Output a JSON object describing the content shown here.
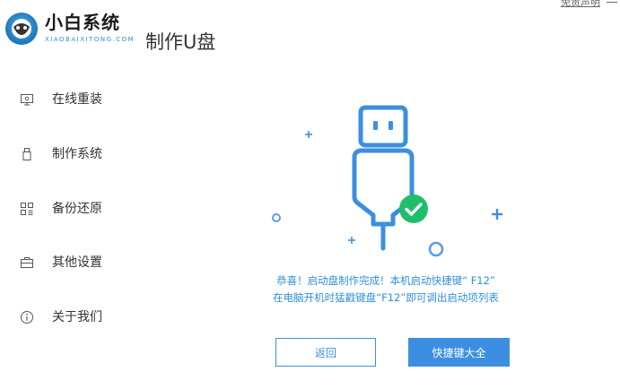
{
  "app": {
    "brand_name": "小白系统",
    "brand_sub": "XIAOBAIXITONG.COM",
    "page_title": "制作U盘",
    "disclaimer": "免责声明"
  },
  "sidebar": {
    "items": [
      {
        "label": "在线重装",
        "icon": "monitor-icon"
      },
      {
        "label": "制作系统",
        "icon": "usb-icon"
      },
      {
        "label": "备份还原",
        "icon": "backup-icon"
      },
      {
        "label": "其他设置",
        "icon": "toolbox-icon"
      },
      {
        "label": "关于我们",
        "icon": "info-icon"
      }
    ]
  },
  "main": {
    "message_line1": "恭喜！启动盘制作完成！本机启动快捷键“ F12”",
    "message_line2": "在电脑开机时猛戳键盘“F12”即可调出启动项列表",
    "back_label": "返回",
    "hotkeys_label": "快捷键大全"
  },
  "colors": {
    "accent": "#3c8fe0",
    "success": "#1fbf6a",
    "text_blue": "#2f8fd8"
  }
}
